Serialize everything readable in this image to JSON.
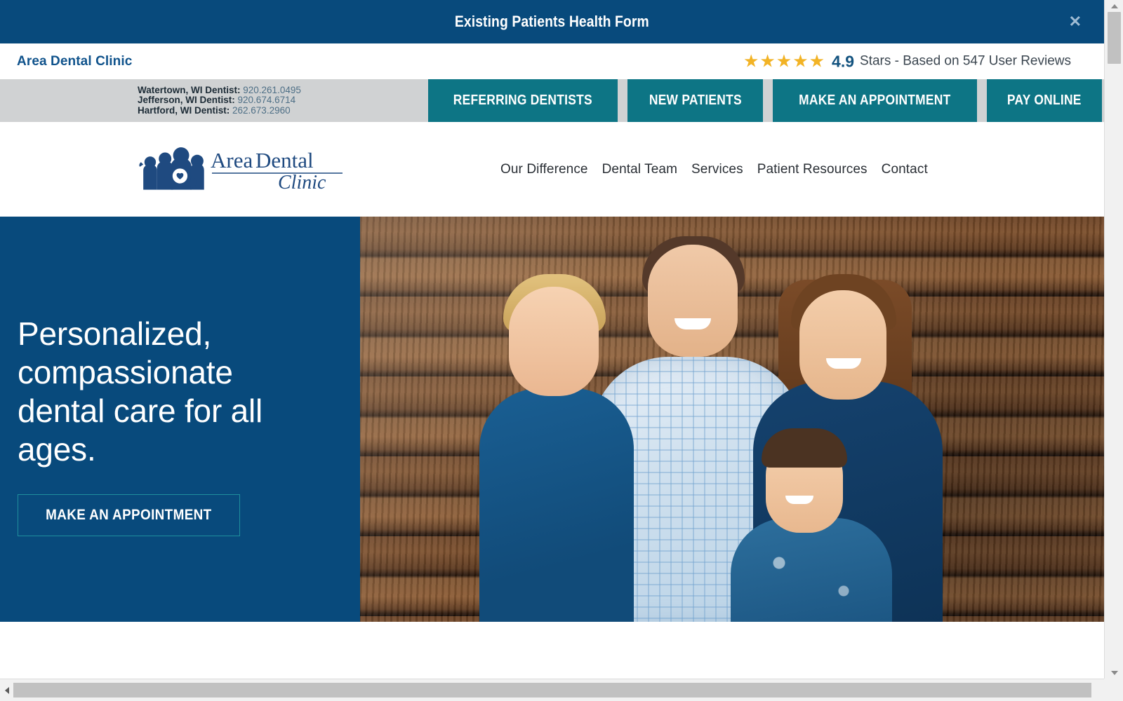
{
  "announcement": {
    "text": "Existing Patients Health Form",
    "close_label": "✕"
  },
  "review_strip": {
    "brand": "Area Dental Clinic",
    "rating": "4.9",
    "rating_text": "Stars - Based on 547 User Reviews",
    "star_count": 5,
    "star_glyph": "★",
    "star_color": "#f2b325",
    "brand_color": "#10538c"
  },
  "action_bar": {
    "locations": [
      {
        "label": "Watertown, WI Dentist:",
        "phone": "920.261.0495"
      },
      {
        "label": "Jefferson, WI Dentist:",
        "phone": "920.674.6714"
      },
      {
        "label": "Hartford, WI Dentist:",
        "phone": "262.673.2960"
      }
    ],
    "buttons": [
      "REFERRING DENTISTS",
      "NEW PATIENTS",
      "MAKE AN APPOINTMENT",
      "PAY ONLINE"
    ],
    "button_color": "#0d7585",
    "bar_color": "#d0d2d3"
  },
  "nav": {
    "logo_text_primary": "Area",
    "logo_text_secondary": "Dental",
    "logo_text_script": "Clinic",
    "links": [
      "Our Difference",
      "Dental Team",
      "Services",
      "Patient Resources",
      "Contact"
    ]
  },
  "hero": {
    "headline": "Personalized, compassionate dental care for all ages.",
    "cta_label": "MAKE AN APPOINTMENT",
    "panel_color": "#084a7c",
    "cta_border_color": "#1f8f9d",
    "photo_alt": "Family of four smiling in front of a rustic wood plank wall"
  },
  "scrollbars": {
    "vertical_up": "▲",
    "vertical_down": "▼",
    "horizontal_left": "◀",
    "horizontal_right": "▶"
  }
}
